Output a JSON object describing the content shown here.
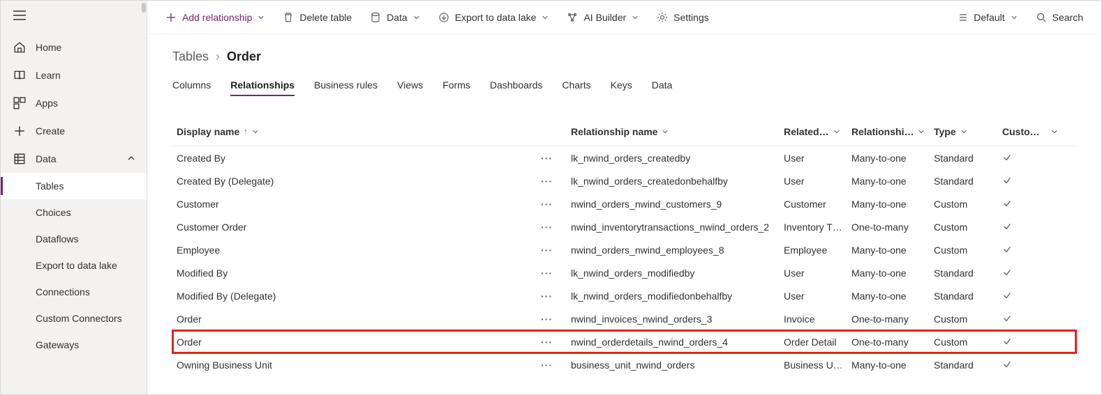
{
  "sidebar": {
    "items": [
      {
        "label": "Home",
        "icon": "home-icon"
      },
      {
        "label": "Learn",
        "icon": "learn-icon"
      },
      {
        "label": "Apps",
        "icon": "apps-icon"
      },
      {
        "label": "Create",
        "icon": "plus-icon"
      },
      {
        "label": "Data",
        "icon": "data-icon",
        "expanded": true
      }
    ],
    "dataSub": [
      {
        "label": "Tables",
        "selected": true
      },
      {
        "label": "Choices"
      },
      {
        "label": "Dataflows"
      },
      {
        "label": "Export to data lake"
      },
      {
        "label": "Connections"
      },
      {
        "label": "Custom Connectors"
      },
      {
        "label": "Gateways"
      }
    ]
  },
  "commandBar": {
    "add": "Add relationship",
    "delete": "Delete table",
    "data": "Data",
    "export": "Export to data lake",
    "ai": "AI Builder",
    "settings": "Settings",
    "view": "Default",
    "search": "Search"
  },
  "breadcrumb": {
    "parent": "Tables",
    "current": "Order"
  },
  "tabs": {
    "list": [
      "Columns",
      "Relationships",
      "Business rules",
      "Views",
      "Forms",
      "Dashboards",
      "Charts",
      "Keys",
      "Data"
    ],
    "active": "Relationships"
  },
  "columns": {
    "displayName": "Display name",
    "relationshipName": "Relationship name",
    "related": "Related…",
    "relationshipType": "Relationshi…",
    "type": "Type",
    "custom": "Custom…"
  },
  "rows": [
    {
      "displayName": "Created By",
      "relName": "lk_nwind_orders_createdby",
      "related": "User",
      "relType": "Many-to-one",
      "type": "Standard",
      "custom": true
    },
    {
      "displayName": "Created By (Delegate)",
      "relName": "lk_nwind_orders_createdonbehalfby",
      "related": "User",
      "relType": "Many-to-one",
      "type": "Standard",
      "custom": true
    },
    {
      "displayName": "Customer",
      "relName": "nwind_orders_nwind_customers_9",
      "related": "Customer",
      "relType": "Many-to-one",
      "type": "Custom",
      "custom": true
    },
    {
      "displayName": "Customer Order",
      "relName": "nwind_inventorytransactions_nwind_orders_2",
      "related": "Inventory T…",
      "relType": "One-to-many",
      "type": "Custom",
      "custom": true
    },
    {
      "displayName": "Employee",
      "relName": "nwind_orders_nwind_employees_8",
      "related": "Employee",
      "relType": "Many-to-one",
      "type": "Custom",
      "custom": true
    },
    {
      "displayName": "Modified By",
      "relName": "lk_nwind_orders_modifiedby",
      "related": "User",
      "relType": "Many-to-one",
      "type": "Standard",
      "custom": true
    },
    {
      "displayName": "Modified By (Delegate)",
      "relName": "lk_nwind_orders_modifiedonbehalfby",
      "related": "User",
      "relType": "Many-to-one",
      "type": "Standard",
      "custom": true
    },
    {
      "displayName": "Order",
      "relName": "nwind_invoices_nwind_orders_3",
      "related": "Invoice",
      "relType": "One-to-many",
      "type": "Custom",
      "custom": true
    },
    {
      "displayName": "Order",
      "relName": "nwind_orderdetails_nwind_orders_4",
      "related": "Order Detail",
      "relType": "One-to-many",
      "type": "Custom",
      "custom": true,
      "highlighted": true
    },
    {
      "displayName": "Owning Business Unit",
      "relName": "business_unit_nwind_orders",
      "related": "Business U…",
      "relType": "Many-to-one",
      "type": "Standard",
      "custom": true
    }
  ]
}
